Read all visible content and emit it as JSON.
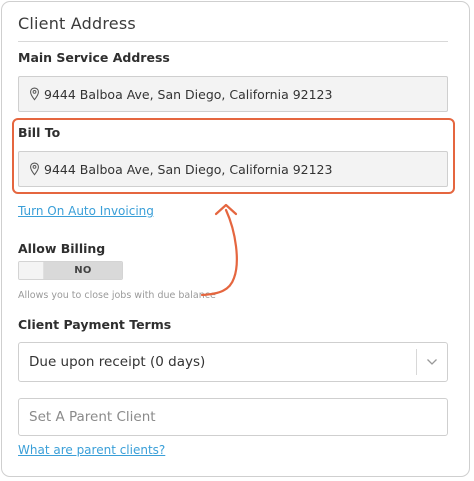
{
  "section": {
    "title": "Client Address"
  },
  "main_service": {
    "label": "Main Service Address",
    "address": "9444 Balboa Ave, San Diego, California 92123"
  },
  "bill_to": {
    "label": "Bill To",
    "address": "9444 Balboa Ave, San Diego, California 92123"
  },
  "links": {
    "auto_invoicing": "Turn On Auto Invoicing",
    "parent_clients": "What are parent clients?"
  },
  "allow_billing": {
    "label": "Allow Billing",
    "toggle_value": "NO",
    "helper": "Allows you to close jobs with due balance"
  },
  "payment_terms": {
    "label": "Client Payment Terms",
    "selected": "Due upon receipt (0 days)"
  },
  "parent_client": {
    "placeholder": "Set A Parent Client"
  },
  "colors": {
    "highlight": "#e5663f",
    "link": "#3a9fd8"
  },
  "icons": {
    "address": "map-pin-icon",
    "select": "chevron-down-icon"
  }
}
